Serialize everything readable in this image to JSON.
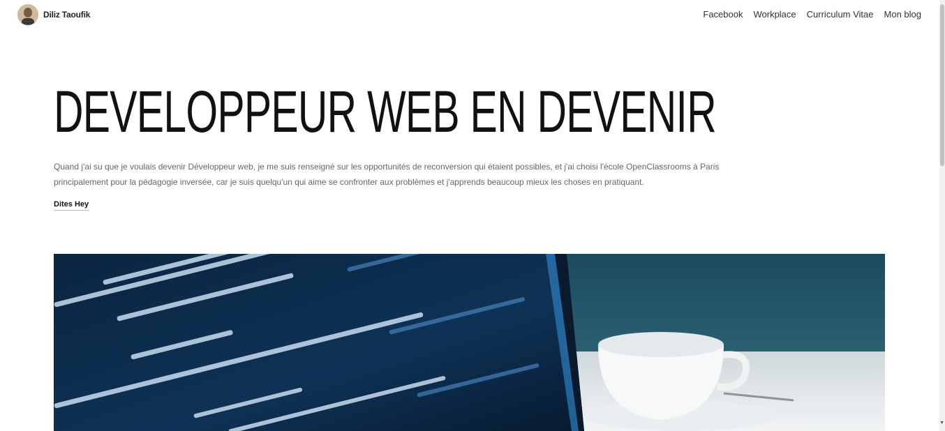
{
  "header": {
    "brand_name": "Diliz Taoufik",
    "nav": [
      {
        "label": "Facebook"
      },
      {
        "label": "Workplace"
      },
      {
        "label": "Curriculum Vitae"
      },
      {
        "label": "Mon blog"
      }
    ]
  },
  "hero": {
    "title": "DEVELOPPEUR WEB EN DEVENIR",
    "description": "Quand j'ai su que je voulais devenir Développeur web, je me suis renseigné sur les opportunités de reconversion qui étaient possibles, et j'ai choisi l'école OpenClassrooms à Paris principalement pour la pédagogie inversée, car je suis quelqu'un qui aime se confronter aux problèmes et j'apprends beaucoup mieux les choses en pratiquant.",
    "cta_label": "Dites Hey"
  },
  "colors": {
    "code_background": "#0c2a4a",
    "code_text": "#c8dcf0",
    "cup_background": "#1d4f63"
  }
}
